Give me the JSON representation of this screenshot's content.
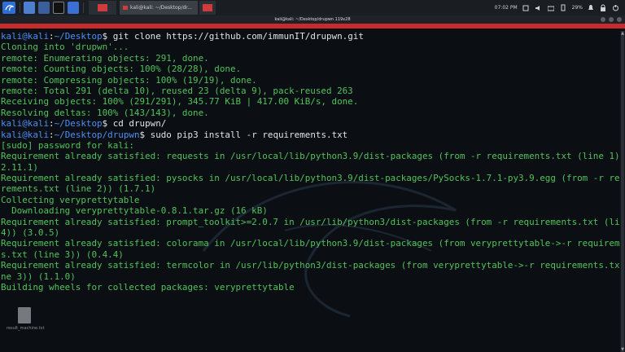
{
  "taskbar": {
    "windows": [
      {
        "label": "",
        "icon": "terminal-icon"
      },
      {
        "label": "kali@kali: ~/Desktop/dr...",
        "icon": "terminal-icon"
      }
    ],
    "clock": "07:02 PM",
    "battery": "29%"
  },
  "window": {
    "title": "kali@kali: ~/Desktop/drupwn 119x28"
  },
  "terminal": {
    "lines": [
      {
        "kind": "prompt",
        "user": "kali",
        "host": "kali",
        "path": "~/Desktop",
        "cmd": "git clone https://github.com/immunIT/drupwn.git"
      },
      {
        "kind": "out",
        "text": "Cloning into 'drupwn'..."
      },
      {
        "kind": "out",
        "text": "remote: Enumerating objects: 291, done."
      },
      {
        "kind": "out",
        "text": "remote: Counting objects: 100% (28/28), done."
      },
      {
        "kind": "out",
        "text": "remote: Compressing objects: 100% (19/19), done."
      },
      {
        "kind": "out",
        "text": "remote: Total 291 (delta 10), reused 23 (delta 9), pack-reused 263"
      },
      {
        "kind": "out",
        "text": "Receiving objects: 100% (291/291), 345.77 KiB | 417.00 KiB/s, done."
      },
      {
        "kind": "out",
        "text": "Resolving deltas: 100% (143/143), done."
      },
      {
        "kind": "prompt",
        "user": "kali",
        "host": "kali",
        "path": "~/Desktop",
        "cmd": "cd drupwn/"
      },
      {
        "kind": "prompt",
        "user": "kali",
        "host": "kali",
        "path": "~/Desktop/drupwn",
        "cmd": "sudo pip3 install -r requirements.txt"
      },
      {
        "kind": "out",
        "text": "[sudo] password for kali:"
      },
      {
        "kind": "out",
        "text": "Requirement already satisfied: requests in /usr/local/lib/python3.9/dist-packages (from -r requirements.txt (line 1)) ("
      },
      {
        "kind": "out",
        "text": "2.11.1)"
      },
      {
        "kind": "out",
        "text": "Requirement already satisfied: pysocks in /usr/local/lib/python3.9/dist-packages/PySocks-1.7.1-py3.9.egg (from -r requi"
      },
      {
        "kind": "out",
        "text": "rements.txt (line 2)) (1.7.1)"
      },
      {
        "kind": "out",
        "text": "Collecting veryprettytable"
      },
      {
        "kind": "out",
        "text": "  Downloading veryprettytable-0.8.1.tar.gz (16 kB)"
      },
      {
        "kind": "out",
        "text": "Requirement already satisfied: prompt_toolkit>=2.0.7 in /usr/lib/python3/dist-packages (from -r requirements.txt (line"
      },
      {
        "kind": "out",
        "text": "4)) (3.0.5)"
      },
      {
        "kind": "out",
        "text": "Requirement already satisfied: colorama in /usr/local/lib/python3.9/dist-packages (from veryprettytable->-r requirement"
      },
      {
        "kind": "out",
        "text": "s.txt (line 3)) (0.4.4)"
      },
      {
        "kind": "out",
        "text": "Requirement already satisfied: termcolor in /usr/lib/python3/dist-packages (from veryprettytable->-r requirements.txt (li"
      },
      {
        "kind": "out",
        "text": "ne 3)) (1.1.0)"
      },
      {
        "kind": "out",
        "text": "Building wheels for collected packages: veryprettytable"
      }
    ]
  },
  "desktop": {
    "file_label": "result_machine.txt"
  },
  "colors": {
    "output": "#52c25a",
    "prompt": "#4d8ef5",
    "command": "#dfe3e8",
    "accent": "#c92a2a"
  }
}
